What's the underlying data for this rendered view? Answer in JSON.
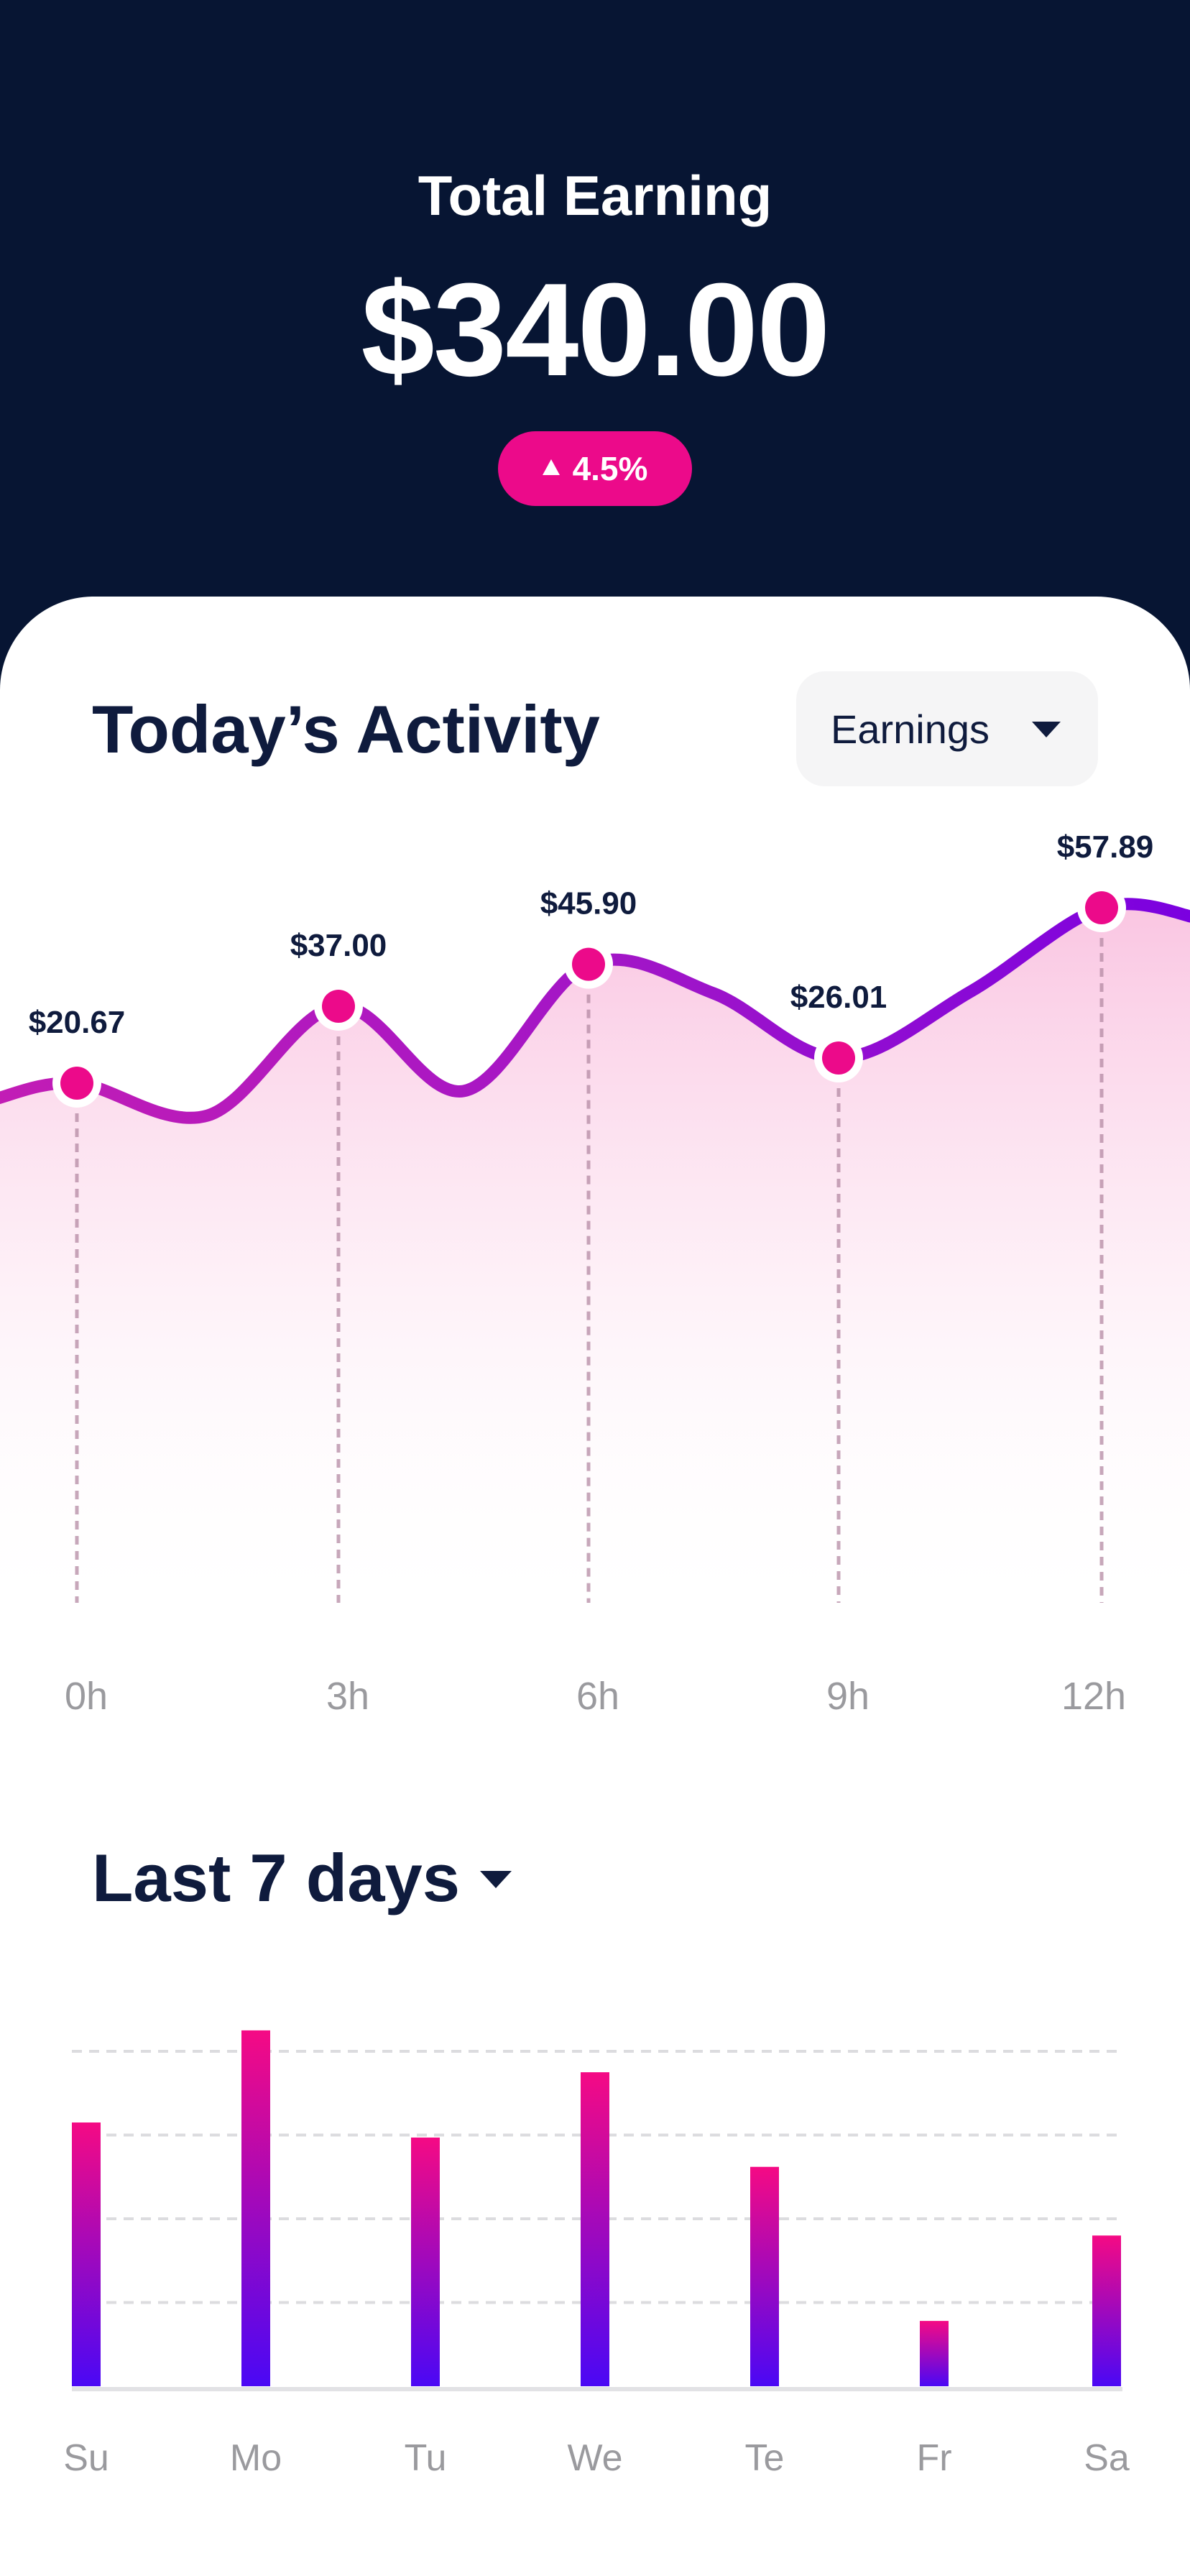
{
  "header": {
    "title": "Total Earning",
    "amount": "$340.00",
    "change": "4.5%",
    "change_direction": "up",
    "change_icon": "triangle-up-icon"
  },
  "activity": {
    "title": "Today’s Activity",
    "dropdown_value": "Earnings",
    "dropdown_icon": "caret-down-icon"
  },
  "range": {
    "title": "Last 7 days",
    "dropdown_icon": "caret-down-icon"
  },
  "colors": {
    "background": "#071533",
    "accent": "#EC0A8A",
    "line_start": "#C21DB5",
    "line_end": "#7A00E0",
    "bar_top": "#F50A84",
    "bar_bottom": "#4A08F5",
    "text_dark": "#0F1B3D",
    "text_muted": "#9A9A9E"
  },
  "chart_data": [
    {
      "type": "line",
      "title": "",
      "categories": [
        "0h",
        "3h",
        "6h",
        "9h",
        "12h"
      ],
      "values": [
        20.67,
        37.0,
        45.9,
        26.01,
        57.89
      ],
      "labels": [
        "$20.67",
        "$37.00",
        "$45.90",
        "$26.01",
        "$57.89"
      ],
      "xlabel": "",
      "ylabel": "",
      "grid": false
    },
    {
      "type": "bar",
      "title": "",
      "categories": [
        "Su",
        "Mo",
        "Tu",
        "We",
        "Te",
        "Fr",
        "Sa"
      ],
      "values": [
        3.15,
        4.25,
        2.97,
        3.75,
        2.62,
        0.78,
        1.8
      ],
      "ylim": [
        0,
        4
      ],
      "grid": true
    }
  ]
}
